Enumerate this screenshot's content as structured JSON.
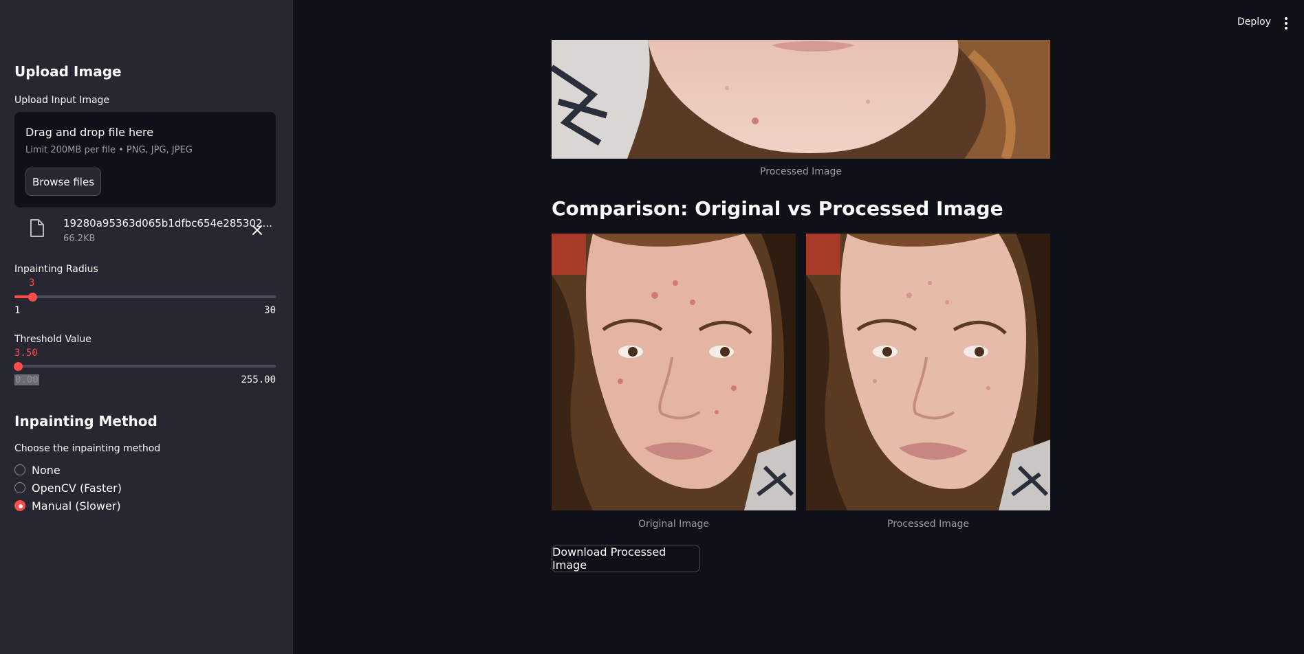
{
  "sidebar": {
    "upload_heading": "Upload Image",
    "upload_label": "Upload Input Image",
    "uploader": {
      "title": "Drag and drop file here",
      "limit": "Limit 200MB per file • PNG, JPG, JPEG",
      "browse_label": "Browse files"
    },
    "file": {
      "name": "19280a95363d065b1dfbc654e285302...",
      "size": "66.2KB"
    },
    "radius_slider": {
      "label": "Inpainting Radius",
      "value": "3",
      "min": "1",
      "max": "30",
      "fraction": 0.069
    },
    "threshold_slider": {
      "label": "Threshold Value",
      "value": "3.50",
      "min": "0.00",
      "max": "255.00",
      "fraction": 0.0137
    },
    "method_heading": "Inpainting Method",
    "method_label": "Choose the inpainting method",
    "methods": [
      {
        "label": "None",
        "selected": false
      },
      {
        "label": "OpenCV (Faster)",
        "selected": false
      },
      {
        "label": "Manual (Slower)",
        "selected": true
      }
    ]
  },
  "header": {
    "deploy_label": "Deploy"
  },
  "main": {
    "top_caption": "Processed Image",
    "comparison_title": "Comparison: Original vs Processed Image",
    "original_caption": "Original Image",
    "processed_caption": "Processed Image",
    "download_label": "Download Processed Image"
  },
  "colors": {
    "accent": "#ff4b4b",
    "background": "#0e1117",
    "sidebar": "#262730"
  }
}
